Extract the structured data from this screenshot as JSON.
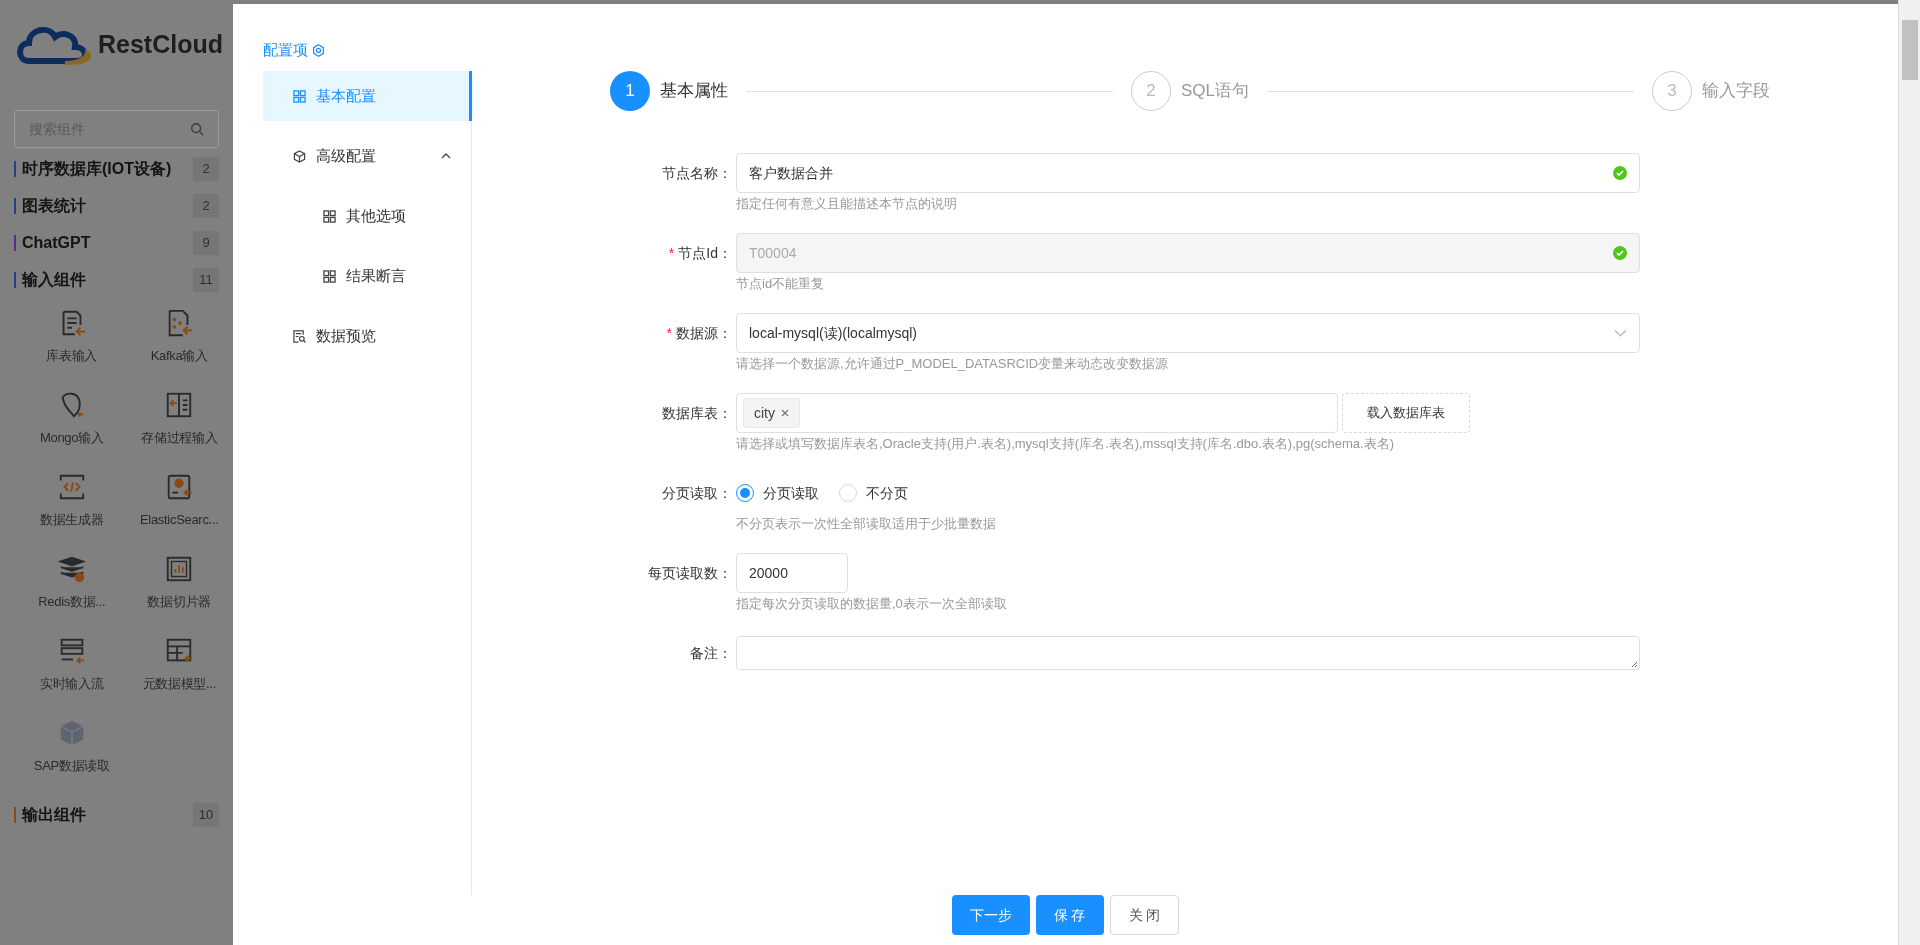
{
  "sidebar": {
    "logo_text": "RestCloud",
    "search": {
      "placeholder": "搜索组件"
    },
    "categories": [
      {
        "label": "时序数据库(IOT设备)",
        "count": "2",
        "color": "#22418a"
      },
      {
        "label": "图表统计",
        "count": "2",
        "color": "#22418a"
      },
      {
        "label": "ChatGPT",
        "count": "9",
        "color": "#5b2d8a"
      },
      {
        "label": "输入组件",
        "count": "11",
        "color": "#22418a",
        "items": [
          "库表输入",
          "Kafka输入",
          "Mongo输入",
          "存储过程输入",
          "数据生成器",
          "ElasticSearc...",
          "Redis数据...",
          "数据切片器",
          "实时输入流",
          "元数据模型...",
          "SAP数据读取"
        ]
      },
      {
        "label": "输出组件",
        "count": "10",
        "color": "#8a4a12"
      }
    ]
  },
  "drawer": {
    "title": "配置项",
    "menu": [
      {
        "label": "基本配置",
        "selected": true
      },
      {
        "label": "高级配置",
        "selected": false,
        "expanded": true,
        "children": [
          {
            "label": "其他选项",
            "selected": false
          },
          {
            "label": "结果断言",
            "selected": false
          }
        ]
      },
      {
        "label": "数据预览",
        "selected": false
      }
    ],
    "steps": [
      {
        "number": "1",
        "label": "基本属性",
        "active": true
      },
      {
        "number": "2",
        "label": "SQL语句",
        "active": false
      },
      {
        "number": "3",
        "label": "输入字段",
        "active": false
      }
    ],
    "form": [
      {
        "kind": "input",
        "label": "节点名称：",
        "value": "客户数据合并",
        "valid": true,
        "disabled": false,
        "help": "指定任何有意义且能描述本节点的说明"
      },
      {
        "kind": "input",
        "label": "节点Id：",
        "required_mark": "*",
        "value": "T00004",
        "valid": true,
        "disabled": true,
        "help": "节点id不能重复"
      },
      {
        "kind": "select",
        "label": "数据源：",
        "required_mark": "*",
        "value": "local-mysql(读)(localmysql)",
        "help": "请选择一个数据源,允许通过P_MODEL_DATASRCID变量来动态改变数据源"
      },
      {
        "kind": "tags",
        "label": "数据库表：",
        "tags": [
          "city"
        ],
        "button": "载入数据库表",
        "help": "请选择或填写数据库表名,Oracle支持(用户.表名),mysql支持(库名.表名),mssql支持(库名.dbo.表名),pg(schema.表名)"
      },
      {
        "kind": "radio",
        "label": "分页读取：",
        "options": [
          {
            "label": "分页读取",
            "selected": true
          },
          {
            "label": "不分页",
            "selected": false
          }
        ],
        "help": "不分页表示一次性全部读取适用于少批量数据"
      },
      {
        "kind": "number",
        "label": "每页读取数：",
        "value": "20000",
        "help": "指定每次分页读取的数据量,0表示一次全部读取"
      },
      {
        "kind": "textarea",
        "label": "备注："
      }
    ],
    "buttons": [
      {
        "label": "下一步",
        "primary": true
      },
      {
        "label": "保 存",
        "primary": true
      },
      {
        "label": "关 闭",
        "primary": false
      }
    ]
  }
}
